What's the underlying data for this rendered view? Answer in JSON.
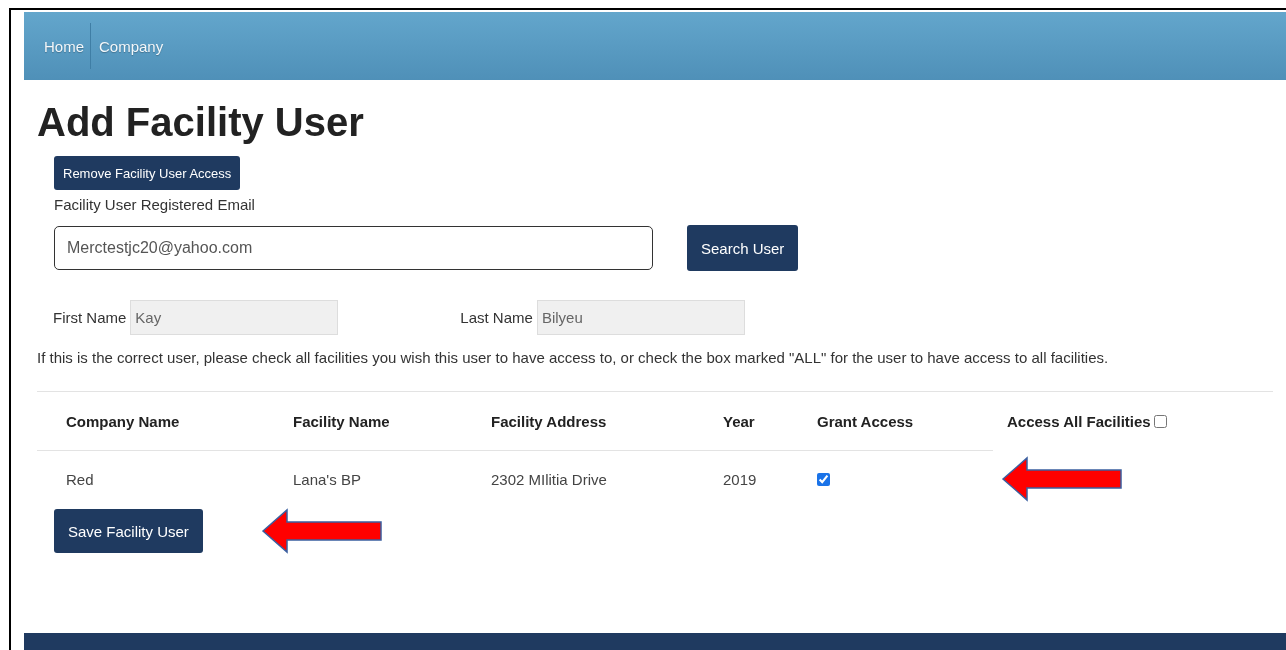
{
  "nav": {
    "items": [
      {
        "label": "Home"
      },
      {
        "label": "Company"
      }
    ]
  },
  "heading": "Add Facility User",
  "remove_button": "Remove Facility User Access",
  "email": {
    "label": "Facility User Registered Email",
    "value": "Merctestjc20@yahoo.com"
  },
  "search_button": "Search User",
  "first_name": {
    "label": "First Name",
    "value": "Kay"
  },
  "last_name": {
    "label": "Last Name",
    "value": "Bilyeu"
  },
  "instruction": "If this is the correct user, please check all facilities you wish this user to have access to, or check the box marked \"ALL\" for the user to have access to all facilities.",
  "table": {
    "columns": [
      "Company Name",
      "Facility Name",
      "Facility Address",
      "Year",
      "Grant Access"
    ],
    "access_all": {
      "label": "Access All Facilities",
      "checked": false
    },
    "rows": [
      {
        "company": "Red",
        "facility": "Lana's BP",
        "address": "2302 MIlitia Drive",
        "year": "2019",
        "grant_access": true
      }
    ]
  },
  "save_button": "Save Facility User"
}
